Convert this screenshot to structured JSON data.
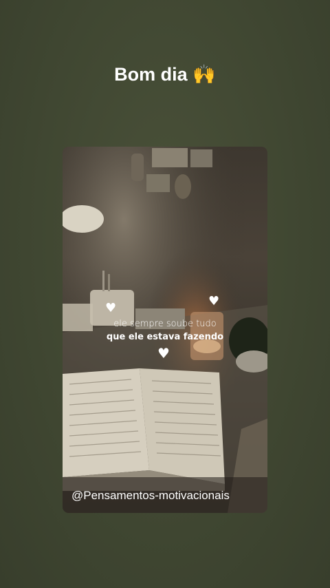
{
  "header": {
    "title": "Bom dia 🙌"
  },
  "post": {
    "quote_line1": "ele sempre soube tudo",
    "quote_line2": "que ele estava fazendo",
    "heart_glyph": "♥",
    "handle": "@Pensamentos-motivacionais"
  },
  "colors": {
    "background": "#414833",
    "text": "#ffffff"
  }
}
